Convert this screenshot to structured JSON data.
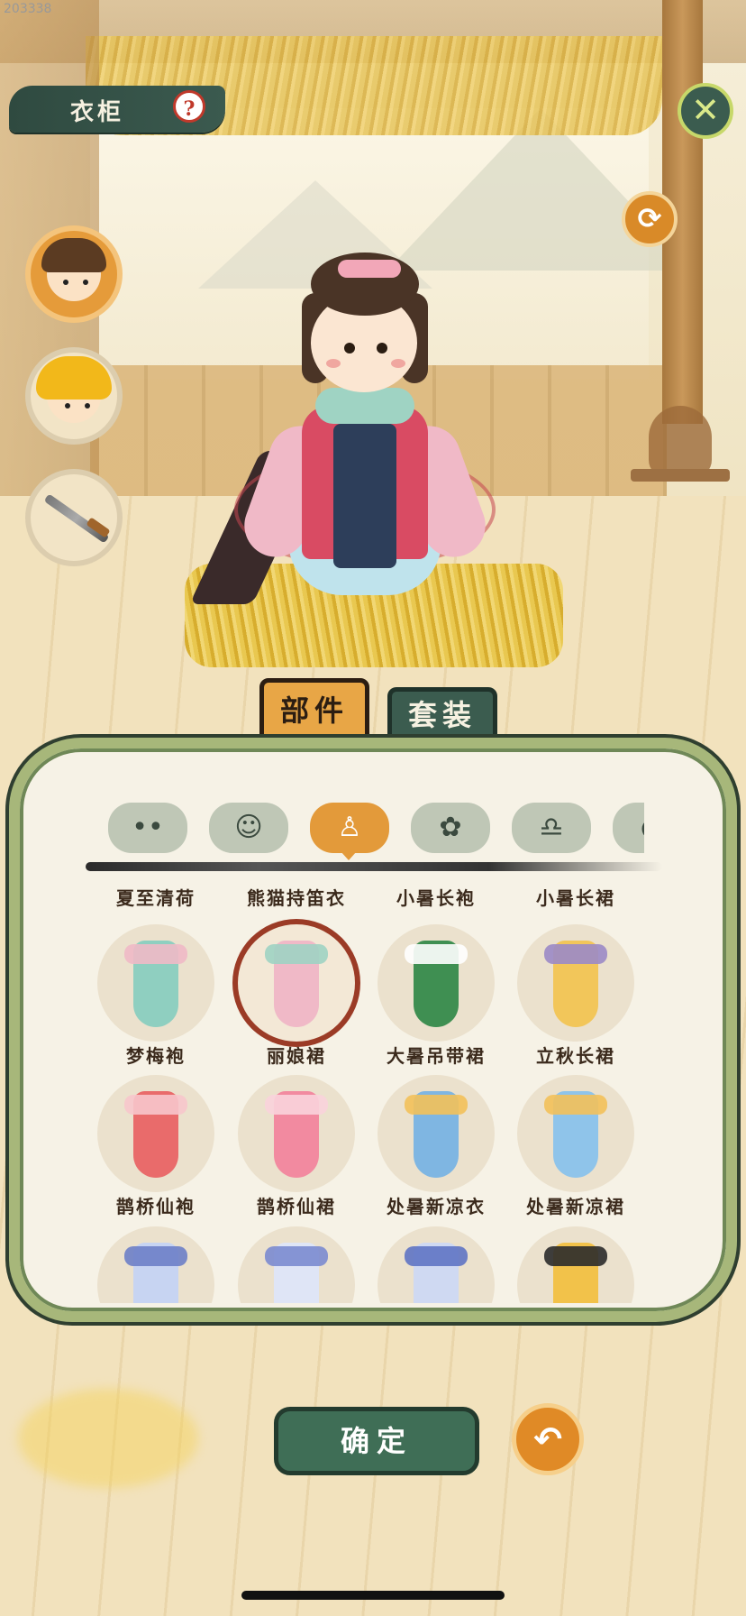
{
  "watermark": "203338",
  "header": {
    "title": "衣柜",
    "help_icon": "question-icon",
    "close_icon": "close-x-icon",
    "refresh_icon": "refresh-icon"
  },
  "portraits": [
    {
      "name": "boy-portrait",
      "active": true
    },
    {
      "name": "golden-hair-portrait",
      "active": false
    },
    {
      "name": "sword-portrait",
      "active": false
    }
  ],
  "tabs": {
    "parts_label": "部件",
    "sets_label": "套装",
    "active": "parts"
  },
  "categories": [
    {
      "icon": "face-icon",
      "glyph": "••"
    },
    {
      "icon": "hair-icon",
      "glyph": "☺"
    },
    {
      "icon": "clothing-icon",
      "glyph": "♙",
      "active": true
    },
    {
      "icon": "flower-icon",
      "glyph": "✿"
    },
    {
      "icon": "cloak-icon",
      "glyph": "♎"
    },
    {
      "icon": "more-icon",
      "glyph": "◐"
    }
  ],
  "outfits": {
    "header_labels": [
      "夏至清荷",
      "熊猫持笛衣",
      "小暑长袍",
      "小暑长裙"
    ],
    "row1": [
      {
        "label": "梦梅袍",
        "color": "#8fcfc0",
        "accent": "#f0b9c7"
      },
      {
        "label": "丽娘裙",
        "color": "#f0b9c7",
        "accent": "#9fd3c3",
        "selected": true
      },
      {
        "label": "大暑吊带裙",
        "color": "#3f8f52",
        "accent": "#ffffff"
      },
      {
        "label": "立秋长裙",
        "color": "#f2c65a",
        "accent": "#9b8ac7"
      }
    ],
    "row2": [
      {
        "label": "鹊桥仙袍",
        "color": "#e96b6b",
        "accent": "#f7c7cc"
      },
      {
        "label": "鹊桥仙裙",
        "color": "#f28aa0",
        "accent": "#f9d3dc"
      },
      {
        "label": "处暑新凉衣",
        "color": "#7fb6e2",
        "accent": "#f3c15a"
      },
      {
        "label": "处暑新凉裙",
        "color": "#8fc4ea",
        "accent": "#f3c15a"
      }
    ],
    "row3": [
      {
        "color": "#c7d4f2",
        "accent": "#6d7fc8"
      },
      {
        "color": "#dfe5f6",
        "accent": "#7b8bd0"
      },
      {
        "color": "#cfd9f2",
        "accent": "#5f74c4"
      },
      {
        "color": "#f2c24a",
        "accent": "#2b2b2b"
      }
    ]
  },
  "footer": {
    "confirm_label": "确定",
    "back_icon": "undo-icon"
  },
  "colors": {
    "accent": "#e39a3a",
    "primary": "#3f6e56",
    "panel_border": "#a7b77a"
  }
}
